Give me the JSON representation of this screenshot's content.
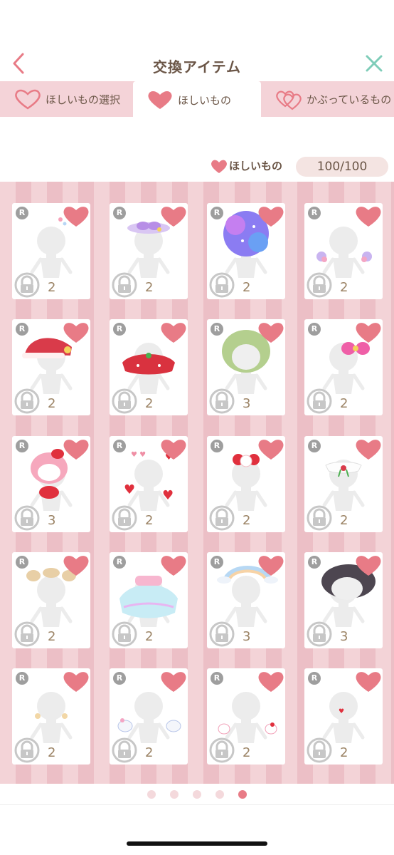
{
  "header": {
    "title": "交換アイテム"
  },
  "tabs": [
    {
      "label": "ほしいもの選択"
    },
    {
      "label": "ほしいもの"
    },
    {
      "label": "かぶっているもの"
    }
  ],
  "counter": {
    "label": "ほしいもの",
    "value": "100/100"
  },
  "items": [
    {
      "rarity": "R",
      "count": "2",
      "accessory": "mannequin-small-charm"
    },
    {
      "rarity": "R",
      "count": "2",
      "accessory": "purple-ears-bow"
    },
    {
      "rarity": "R",
      "count": "2",
      "accessory": "galaxy-afro-wig"
    },
    {
      "rarity": "R",
      "count": "2",
      "accessory": "hand-plushies"
    },
    {
      "rarity": "R",
      "count": "2",
      "accessory": "red-santa-hat"
    },
    {
      "rarity": "R",
      "count": "2",
      "accessory": "red-capelet"
    },
    {
      "rarity": "R",
      "count": "3",
      "accessory": "green-wavy-wig"
    },
    {
      "rarity": "R",
      "count": "2",
      "accessory": "pink-bow"
    },
    {
      "rarity": "R",
      "count": "3",
      "accessory": "melody-plush"
    },
    {
      "rarity": "R",
      "count": "2",
      "accessory": "floating-hearts"
    },
    {
      "rarity": "R",
      "count": "2",
      "accessory": "melody-headband"
    },
    {
      "rarity": "R",
      "count": "2",
      "accessory": "white-collar-ribbon"
    },
    {
      "rarity": "R",
      "count": "2",
      "accessory": "beige-bun-headband"
    },
    {
      "rarity": "R",
      "count": "2",
      "accessory": "pastel-tutu"
    },
    {
      "rarity": "R",
      "count": "3",
      "accessory": "rainbow-cloud"
    },
    {
      "rarity": "R",
      "count": "3",
      "accessory": "dark-short-wig"
    },
    {
      "rarity": "R",
      "count": "2",
      "accessory": "sparkle-cheeks"
    },
    {
      "rarity": "R",
      "count": "2",
      "accessory": "cinnamoroll-plushies"
    },
    {
      "rarity": "R",
      "count": "2",
      "accessory": "kitty-plushies"
    },
    {
      "rarity": "R",
      "count": "2",
      "accessory": "heart-mouth"
    }
  ],
  "pager": {
    "total": 5,
    "active": 5
  },
  "colors": {
    "accent": "#e87b86",
    "tab_bg": "#f4d3d8",
    "stripe_light": "#f3d3d7",
    "stripe_dark": "#ecbfc6",
    "text": "#6b5647"
  }
}
